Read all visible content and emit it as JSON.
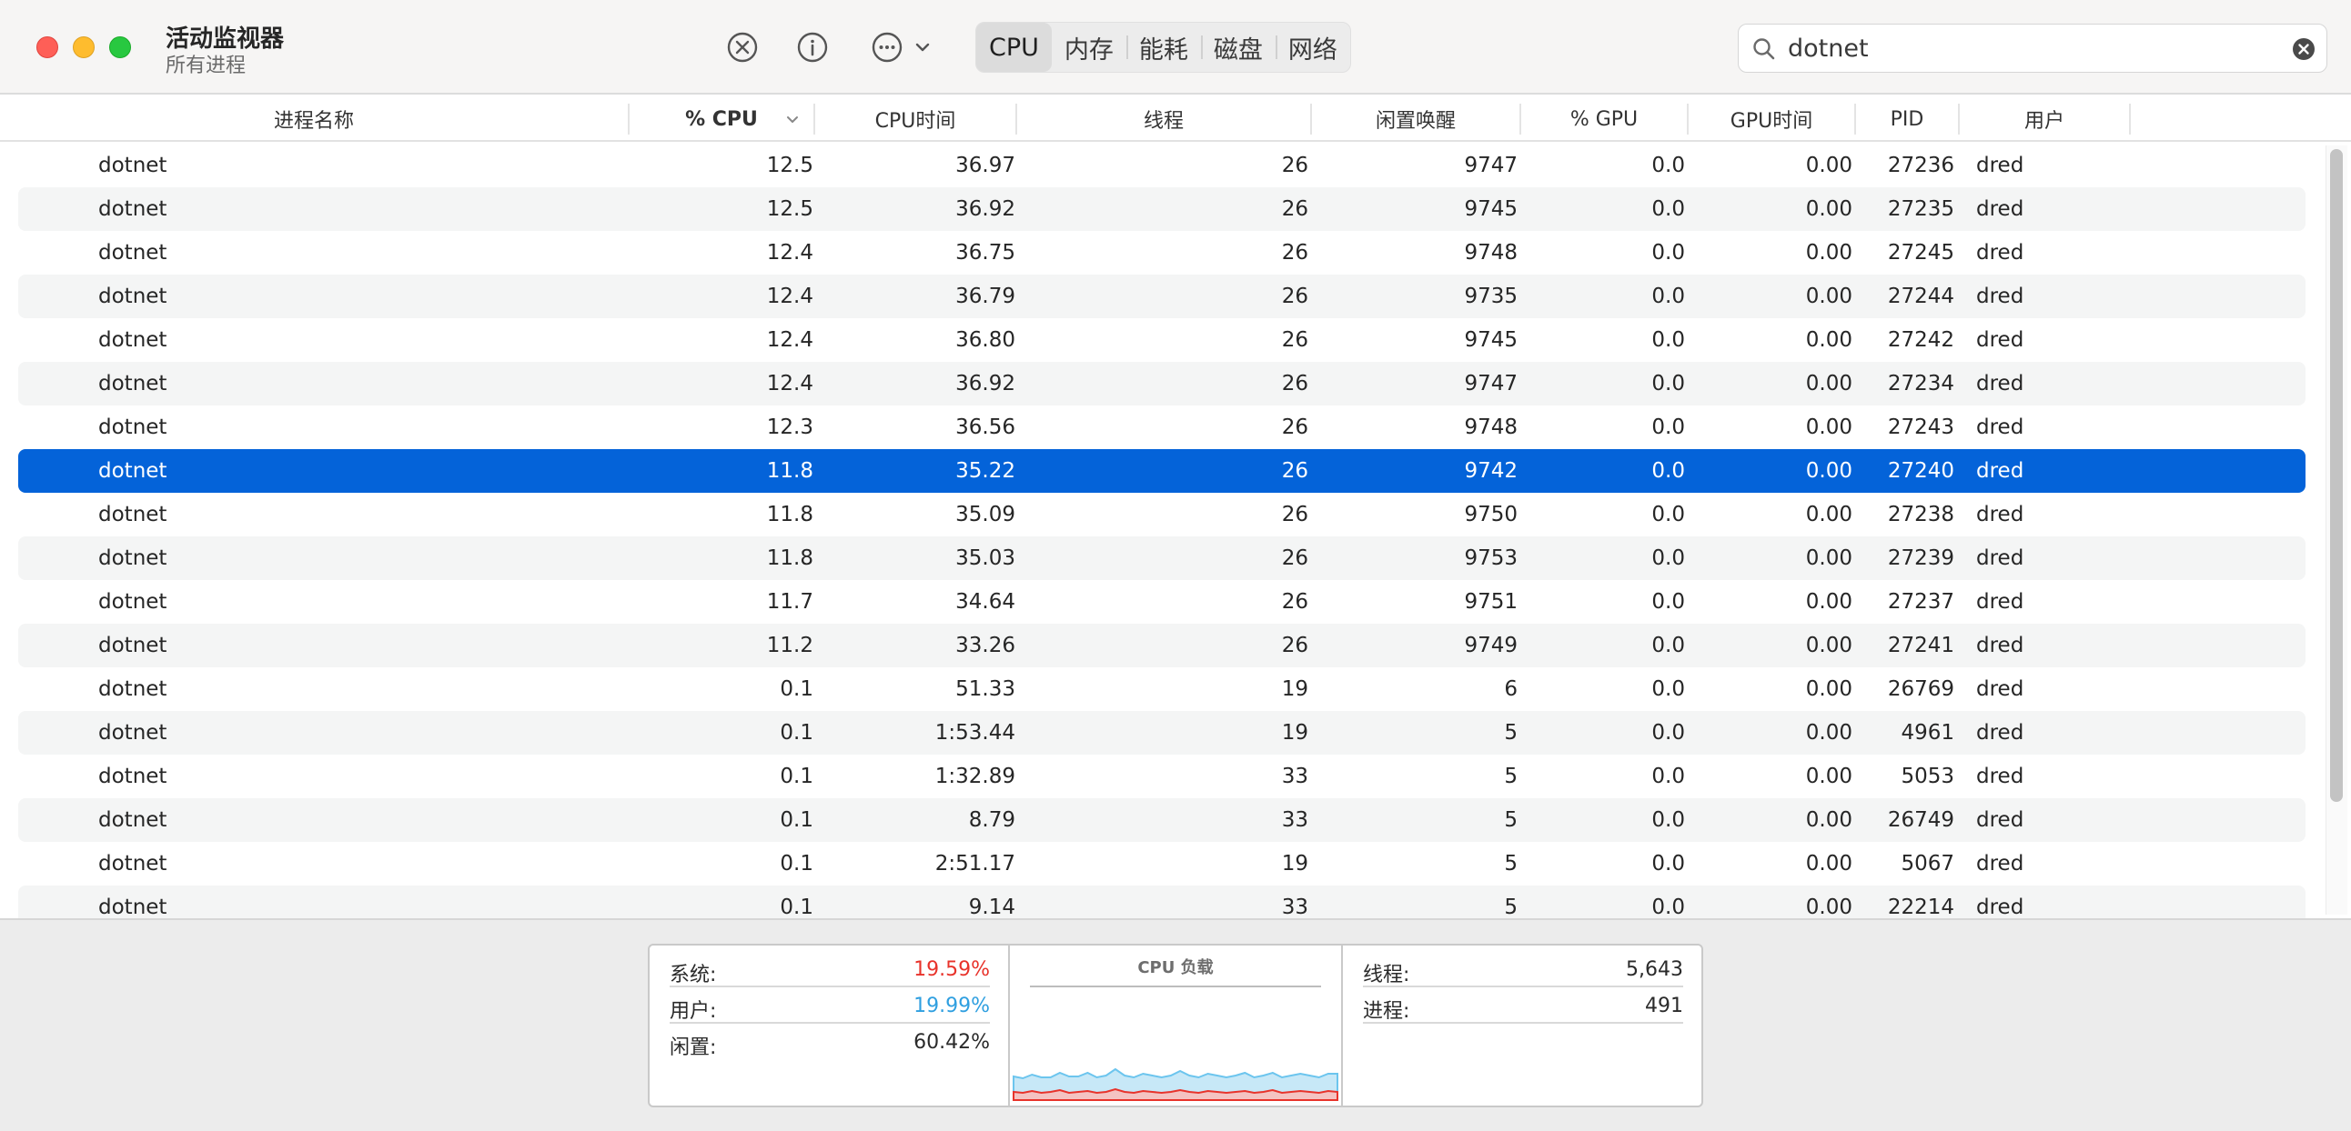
{
  "window": {
    "title": "活动监视器",
    "subtitle": "所有进程"
  },
  "toolbar": {
    "stop_icon": "x-circle-icon",
    "info_icon": "info-icon",
    "more_icon": "ellipsis-circle-icon",
    "tabs": [
      {
        "label": "CPU",
        "active": true
      },
      {
        "label": "内存",
        "active": false
      },
      {
        "label": "能耗",
        "active": false
      },
      {
        "label": "磁盘",
        "active": false
      },
      {
        "label": "网络",
        "active": false
      }
    ]
  },
  "search": {
    "value": "dotnet"
  },
  "columns": [
    "进程名称",
    "% CPU",
    "CPU时间",
    "线程",
    "闲置唤醒",
    "% GPU",
    "GPU时间",
    "PID",
    "用户"
  ],
  "sort_column": "% CPU",
  "rows": [
    [
      "dotnet",
      "12.5",
      "36.97",
      "26",
      "9747",
      "0.0",
      "0.00",
      "27236",
      "dred"
    ],
    [
      "dotnet",
      "12.5",
      "36.92",
      "26",
      "9745",
      "0.0",
      "0.00",
      "27235",
      "dred"
    ],
    [
      "dotnet",
      "12.4",
      "36.75",
      "26",
      "9748",
      "0.0",
      "0.00",
      "27245",
      "dred"
    ],
    [
      "dotnet",
      "12.4",
      "36.79",
      "26",
      "9735",
      "0.0",
      "0.00",
      "27244",
      "dred"
    ],
    [
      "dotnet",
      "12.4",
      "36.80",
      "26",
      "9745",
      "0.0",
      "0.00",
      "27242",
      "dred"
    ],
    [
      "dotnet",
      "12.4",
      "36.92",
      "26",
      "9747",
      "0.0",
      "0.00",
      "27234",
      "dred"
    ],
    [
      "dotnet",
      "12.3",
      "36.56",
      "26",
      "9748",
      "0.0",
      "0.00",
      "27243",
      "dred"
    ],
    [
      "dotnet",
      "11.8",
      "35.22",
      "26",
      "9742",
      "0.0",
      "0.00",
      "27240",
      "dred"
    ],
    [
      "dotnet",
      "11.8",
      "35.09",
      "26",
      "9750",
      "0.0",
      "0.00",
      "27238",
      "dred"
    ],
    [
      "dotnet",
      "11.8",
      "35.03",
      "26",
      "9753",
      "0.0",
      "0.00",
      "27239",
      "dred"
    ],
    [
      "dotnet",
      "11.7",
      "34.64",
      "26",
      "9751",
      "0.0",
      "0.00",
      "27237",
      "dred"
    ],
    [
      "dotnet",
      "11.2",
      "33.26",
      "26",
      "9749",
      "0.0",
      "0.00",
      "27241",
      "dred"
    ],
    [
      "dotnet",
      "0.1",
      "51.33",
      "19",
      "6",
      "0.0",
      "0.00",
      "26769",
      "dred"
    ],
    [
      "dotnet",
      "0.1",
      "1:53.44",
      "19",
      "5",
      "0.0",
      "0.00",
      "4961",
      "dred"
    ],
    [
      "dotnet",
      "0.1",
      "1:32.89",
      "33",
      "5",
      "0.0",
      "0.00",
      "5053",
      "dred"
    ],
    [
      "dotnet",
      "0.1",
      "8.79",
      "33",
      "5",
      "0.0",
      "0.00",
      "26749",
      "dred"
    ],
    [
      "dotnet",
      "0.1",
      "2:51.17",
      "19",
      "5",
      "0.0",
      "0.00",
      "5067",
      "dred"
    ],
    [
      "dotnet",
      "0.1",
      "9.14",
      "33",
      "5",
      "0.0",
      "0.00",
      "22214",
      "dred"
    ]
  ],
  "selected_row": 7,
  "footer": {
    "cpu_stats": [
      {
        "label": "系统:",
        "value": "19.59%",
        "color": "#e8332b"
      },
      {
        "label": "用户:",
        "value": "19.99%",
        "color": "#2f9fe0"
      },
      {
        "label": "闲置:",
        "value": "60.42%",
        "color": "#2a2a2a"
      }
    ],
    "chart_title": "CPU 负载",
    "counts": [
      {
        "label": "线程:",
        "value": "5,643"
      },
      {
        "label": "进程:",
        "value": "491"
      }
    ],
    "system_color": "#e8332b",
    "user_color": "#6cc5ee",
    "cpu_load_system": [
      9,
      8,
      10,
      8,
      9,
      11,
      8,
      9,
      10,
      8,
      9,
      12,
      9,
      8,
      10,
      9,
      8,
      9,
      11,
      9,
      8,
      10,
      9,
      8,
      9,
      10,
      8,
      9,
      11,
      8,
      9,
      10,
      9,
      8,
      10,
      9
    ],
    "cpu_load_user": [
      17,
      16,
      18,
      17,
      16,
      19,
      18,
      17,
      20,
      17,
      18,
      22,
      18,
      17,
      19,
      18,
      17,
      18,
      21,
      18,
      17,
      19,
      18,
      17,
      18,
      20,
      17,
      18,
      19,
      17,
      18,
      19,
      18,
      17,
      19,
      20
    ]
  }
}
